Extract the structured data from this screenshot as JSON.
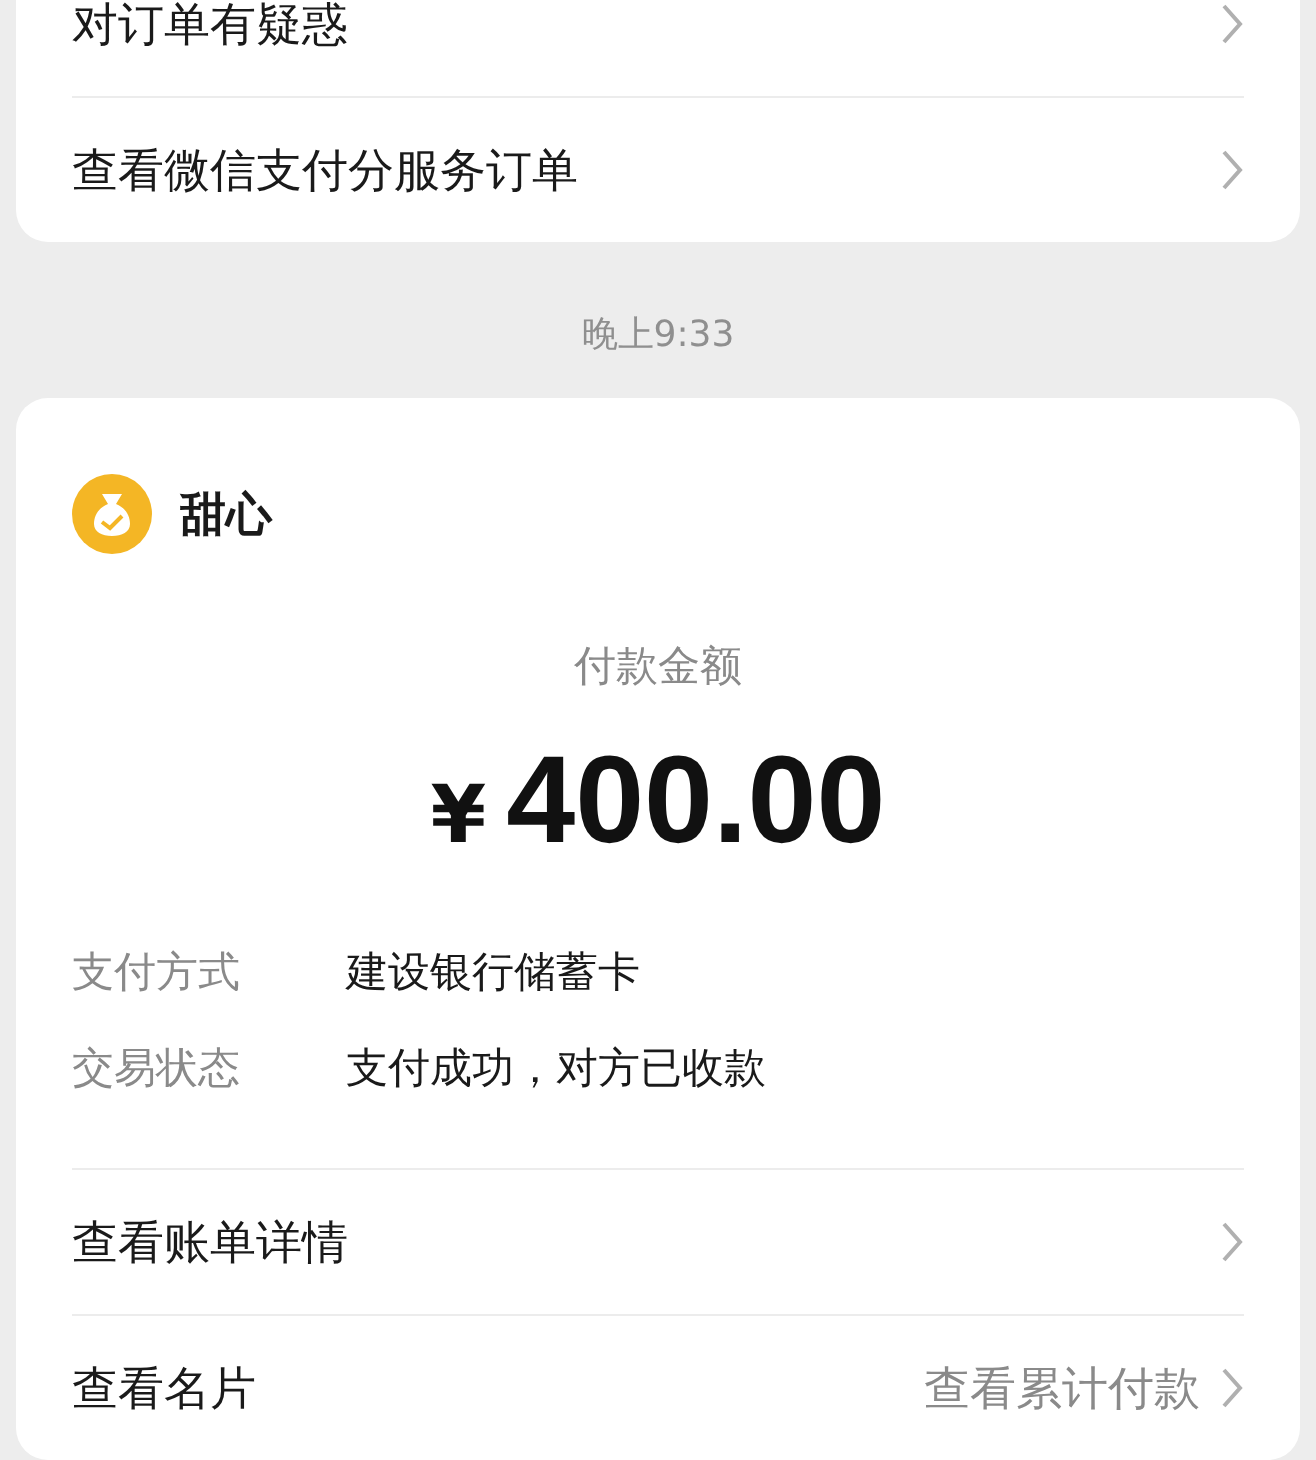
{
  "order_card": {
    "rows": [
      {
        "label": "对订单有疑惑"
      },
      {
        "label": "查看微信支付分服务订单"
      }
    ]
  },
  "timestamp": "晚上9:33",
  "payment_card": {
    "merchant": "甜心",
    "amount_label": "付款金额",
    "currency": "¥",
    "amount": "400.00",
    "details": [
      {
        "label": "支付方式",
        "value": "建设银行储蓄卡"
      },
      {
        "label": "交易状态",
        "value": "支付成功，对方已收款"
      }
    ],
    "rows": [
      {
        "label": "查看账单详情"
      },
      {
        "label": "查看名片",
        "hint": "查看累计付款"
      }
    ]
  }
}
